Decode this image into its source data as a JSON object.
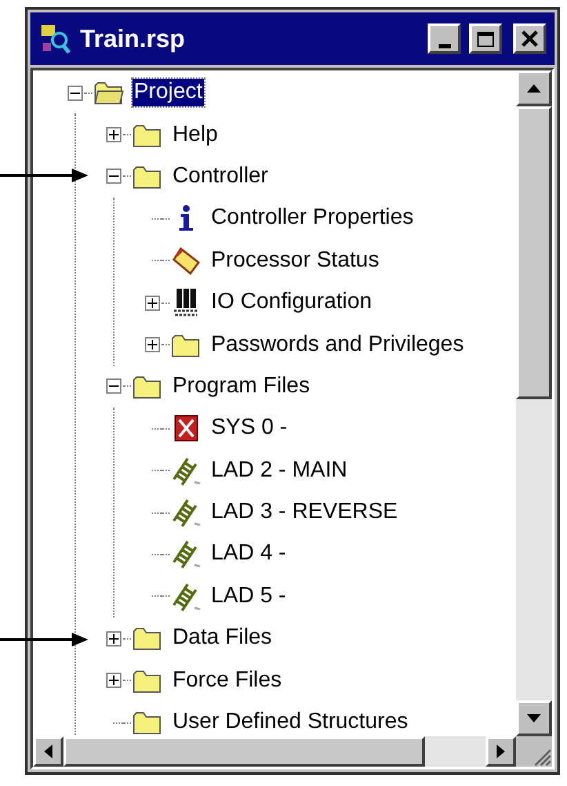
{
  "window": {
    "title": "Train.rsp"
  },
  "tree": [
    {
      "label": "Project",
      "kind": "folder-open",
      "expanded": true,
      "selected": true,
      "children": [
        {
          "label": "Help",
          "kind": "folder",
          "expanded": false,
          "selected": false
        },
        {
          "label": "Controller",
          "kind": "folder",
          "expanded": true,
          "selected": false,
          "children": [
            {
              "label": "Controller Properties",
              "kind": "info",
              "selected": false
            },
            {
              "label": "Processor Status",
              "kind": "status",
              "selected": false
            },
            {
              "label": "IO Configuration",
              "kind": "io",
              "expanded": false,
              "selected": false
            },
            {
              "label": "Passwords and Privileges",
              "kind": "folder",
              "expanded": false,
              "selected": false
            }
          ]
        },
        {
          "label": "Program Files",
          "kind": "folder",
          "expanded": true,
          "selected": false,
          "children": [
            {
              "label": "SYS 0 -",
              "kind": "system",
              "selected": false
            },
            {
              "label": "LAD 2 - MAIN",
              "kind": "ladder",
              "selected": false
            },
            {
              "label": "LAD 3 - REVERSE",
              "kind": "ladder",
              "selected": false
            },
            {
              "label": "LAD 4 -",
              "kind": "ladder",
              "selected": false
            },
            {
              "label": "LAD 5 -",
              "kind": "ladder",
              "selected": false
            }
          ]
        },
        {
          "label": "Data Files",
          "kind": "folder",
          "expanded": false,
          "selected": false
        },
        {
          "label": "Force Files",
          "kind": "folder",
          "expanded": false,
          "selected": false
        },
        {
          "label": "User Defined Structures",
          "kind": "folder",
          "selected": false
        }
      ]
    }
  ]
}
